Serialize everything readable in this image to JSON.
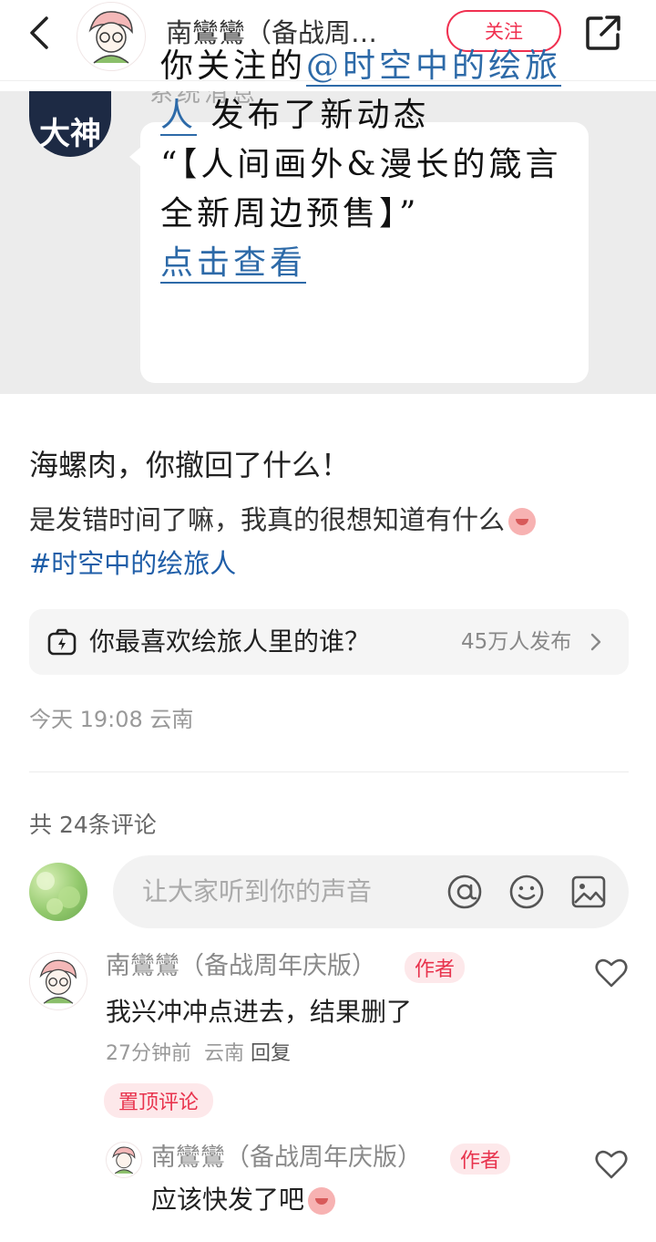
{
  "header": {
    "author_name": "南鸞鸞（备战周…",
    "follow_label": "关注"
  },
  "image": {
    "sender": "系统消息",
    "avatar_label": "大神",
    "message_line1_prefix": "你关注的",
    "message_mention": "@时空中的绘旅人",
    "message_line2": "发布了新动态",
    "message_quote": "“【人间画外&漫长的箴言 全新周边预售】”",
    "message_link": "点击查看"
  },
  "post": {
    "title": "海螺肉，你撤回了什么！",
    "body": "是发错时间了嘛，我真的很想知道有什么",
    "tag": "#时空中的绘旅人"
  },
  "topic": {
    "question": "你最喜欢绘旅人里的谁？",
    "count": "45万人发布"
  },
  "meta": {
    "time_location": "今天 19:08 云南"
  },
  "comments_header": "共 24条评论",
  "comment_input": {
    "placeholder": "让大家听到你的声音"
  },
  "comments": [
    {
      "name": "南鸞鸞（备战周年庆版）",
      "badge": "作者",
      "text": "我兴冲冲点进去，结果删了",
      "time": "27分钟前",
      "location": "云南",
      "reply": "回复",
      "pinned": "置顶评论"
    },
    {
      "name": "南鸞鸞（备战周年庆版）",
      "badge": "作者",
      "text": "应该快发了吧"
    }
  ],
  "colors": {
    "accent": "#f03050",
    "link": "#1f5ea8",
    "badge_bg": "#fde8ea"
  }
}
